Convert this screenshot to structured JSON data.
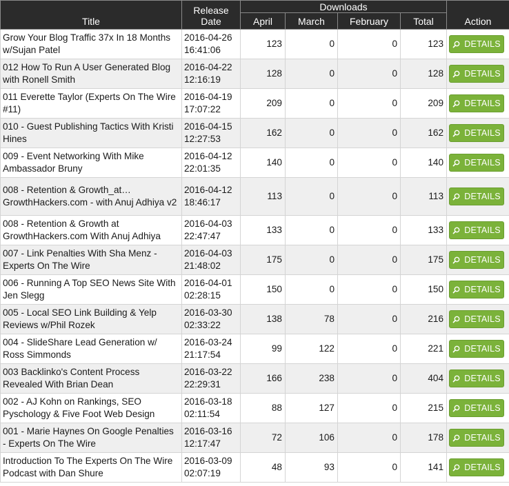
{
  "headers": {
    "title": "Title",
    "release_line1": "Release",
    "release_line2": "Date",
    "downloads": "Downloads",
    "april": "April",
    "march": "March",
    "february": "February",
    "total": "Total",
    "action": "Action"
  },
  "button_label": "DETAILS",
  "icon": "search-icon",
  "colors": {
    "header_bg": "#2b2b2b",
    "button_bg": "#7bb23a",
    "row_alt": "#efefef"
  },
  "rows": [
    {
      "title": "Grow Your Blog Traffic 37x In 18 Months w/Sujan Patel",
      "date": "2016-04-26",
      "time": "16:41:06",
      "april": "123",
      "march": "0",
      "february": "0",
      "total": "123"
    },
    {
      "title": "012 How To Run A User Generated Blog with Ronell Smith",
      "date": "2016-04-22",
      "time": "12:16:19",
      "april": "128",
      "march": "0",
      "february": "0",
      "total": "128"
    },
    {
      "title": "011 Everette Taylor (Experts On The Wire #11)",
      "date": "2016-04-19",
      "time": "17:07:22",
      "april": "209",
      "march": "0",
      "february": "0",
      "total": "209"
    },
    {
      "title": "010 - Guest Publishing Tactics With Kristi Hines",
      "date": "2016-04-15",
      "time": "12:27:53",
      "april": "162",
      "march": "0",
      "february": "0",
      "total": "162"
    },
    {
      "title": "009 - Event Networking With Mike Ambassador Bruny",
      "date": "2016-04-12",
      "time": "22:01:35",
      "april": "140",
      "march": "0",
      "february": "0",
      "total": "140"
    },
    {
      "title": "008 - Retention & Growth_at… GrowthHackers.com - with Anuj Adhiya v2",
      "date": "2016-04-12",
      "time": "18:46:17",
      "april": "113",
      "march": "0",
      "february": "0",
      "total": "113"
    },
    {
      "title": "008 - Retention & Growth at GrowthHackers.com With Anuj Adhiya",
      "date": "2016-04-03",
      "time": "22:47:47",
      "april": "133",
      "march": "0",
      "february": "0",
      "total": "133"
    },
    {
      "title": "007 - Link Penalties With Sha Menz - Experts On The Wire",
      "date": "2016-04-03",
      "time": "21:48:02",
      "april": "175",
      "march": "0",
      "february": "0",
      "total": "175"
    },
    {
      "title": "006 - Running A Top SEO News Site With Jen Slegg",
      "date": "2016-04-01",
      "time": "02:28:15",
      "april": "150",
      "march": "0",
      "february": "0",
      "total": "150"
    },
    {
      "title": "005 - Local SEO Link Building & Yelp Reviews w/Phil Rozek",
      "date": "2016-03-30",
      "time": "02:33:22",
      "april": "138",
      "march": "78",
      "february": "0",
      "total": "216"
    },
    {
      "title": "004 - SlideShare Lead Generation w/ Ross Simmonds",
      "date": "2016-03-24",
      "time": "21:17:54",
      "april": "99",
      "march": "122",
      "february": "0",
      "total": "221"
    },
    {
      "title": "003 Backlinko's Content Process Revealed With Brian Dean",
      "date": "2016-03-22",
      "time": "22:29:31",
      "april": "166",
      "march": "238",
      "february": "0",
      "total": "404"
    },
    {
      "title": "002 - AJ Kohn on Rankings, SEO Pyschology & Five Foot Web Design",
      "date": "2016-03-18",
      "time": "02:11:54",
      "april": "88",
      "march": "127",
      "february": "0",
      "total": "215"
    },
    {
      "title": "001 - Marie Haynes On Google Penalties - Experts On The Wire",
      "date": "2016-03-16",
      "time": "12:17:47",
      "april": "72",
      "march": "106",
      "february": "0",
      "total": "178"
    },
    {
      "title": "Introduction To The Experts On The Wire Podcast with Dan Shure",
      "date": "2016-03-09",
      "time": "02:07:19",
      "april": "48",
      "march": "93",
      "february": "0",
      "total": "141"
    }
  ]
}
